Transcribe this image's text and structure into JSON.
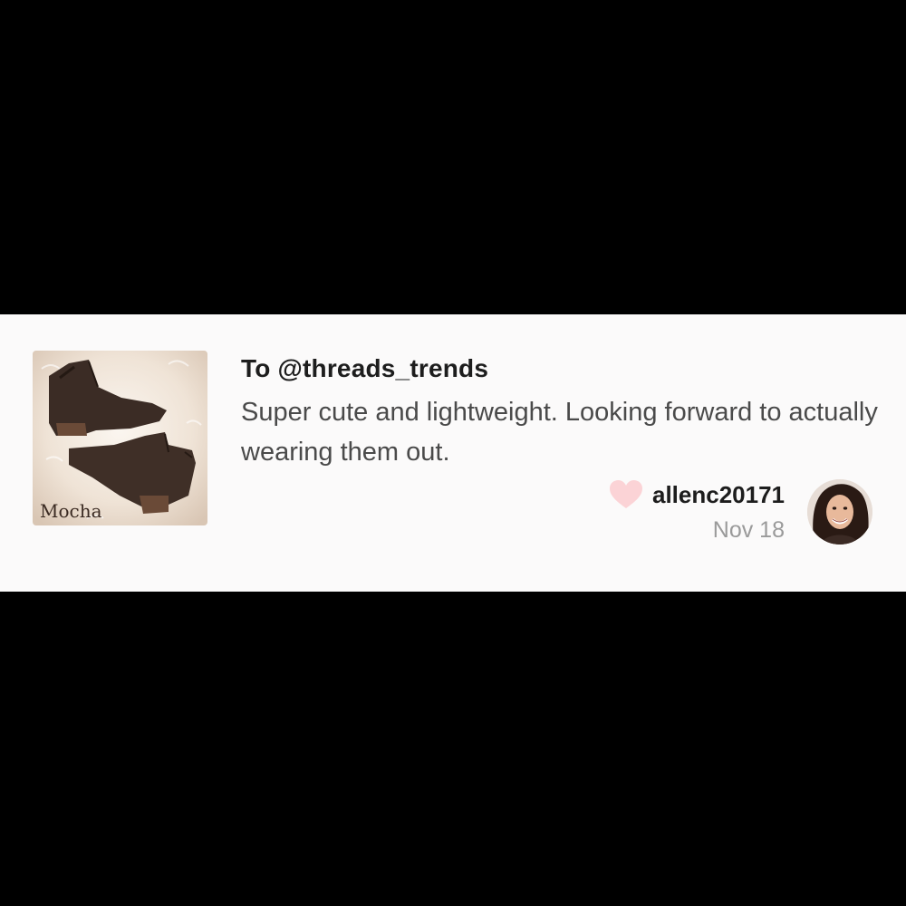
{
  "review": {
    "recipient": "To @threads_trends",
    "text": "Super cute and lightweight. Looking forward to actually wearing them out.",
    "username": "allenc20171",
    "date": "Nov 18",
    "liked_icon": "heart-icon"
  },
  "product": {
    "label": "Mocha"
  },
  "colors": {
    "background": "#000000",
    "card": "#fbfafa",
    "heart": "#fbd3d6",
    "date": "#9a9a9a",
    "text": "#4a4a4a"
  }
}
